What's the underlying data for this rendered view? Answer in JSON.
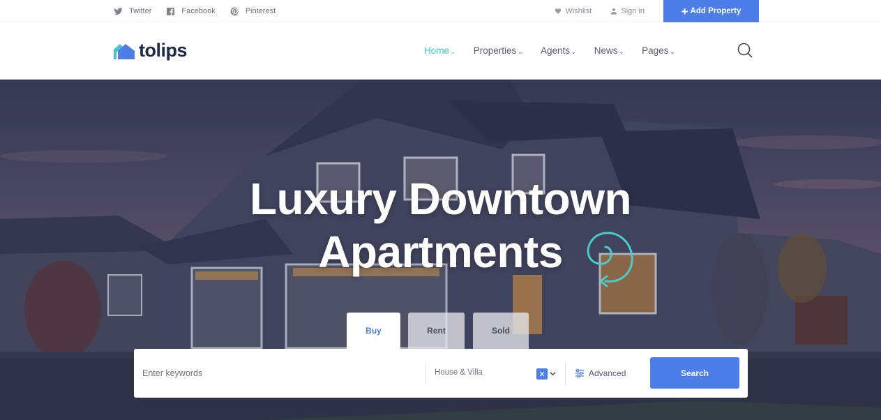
{
  "topbar": {
    "social": [
      {
        "label": "Twitter",
        "icon": "twitter-icon"
      },
      {
        "label": "Facebook",
        "icon": "facebook-icon"
      },
      {
        "label": "Pinterest",
        "icon": "pinterest-icon"
      }
    ],
    "wishlist_label": "Wishlist",
    "signin_label": "Sign in",
    "add_property_label": "Add Property"
  },
  "header": {
    "logo_text": "tolips",
    "nav": [
      {
        "label": "Home",
        "active": true
      },
      {
        "label": "Properties",
        "active": false
      },
      {
        "label": "Agents",
        "active": false
      },
      {
        "label": "News",
        "active": false
      },
      {
        "label": "Pages",
        "active": false
      }
    ]
  },
  "hero": {
    "title_line1": "Luxury Downtown",
    "title_line2": "Apartments"
  },
  "search": {
    "tabs": [
      {
        "label": "Buy",
        "active": true
      },
      {
        "label": "Rent",
        "active": false
      },
      {
        "label": "Sold",
        "active": false
      }
    ],
    "keyword_placeholder": "Enter keywords",
    "property_type_value": "House & Villa",
    "advanced_label": "Advanced",
    "search_button_label": "Search"
  },
  "colors": {
    "accent": "#4d7ee8",
    "teal": "#47c2c6",
    "logo_dark": "#1f2a44"
  }
}
